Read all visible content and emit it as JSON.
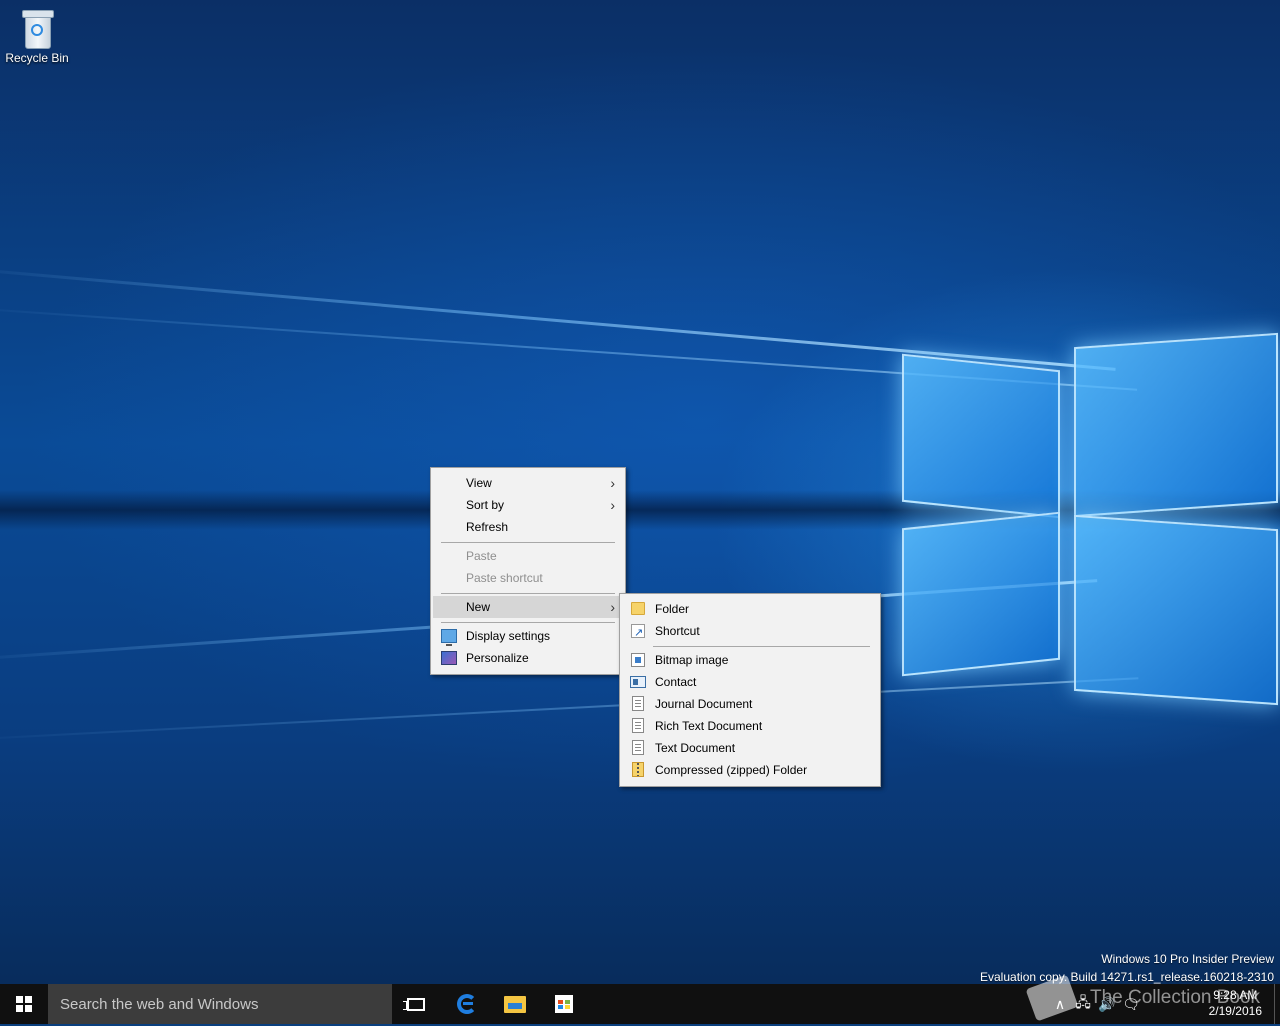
{
  "desktop": {
    "icons": [
      {
        "label": "Recycle Bin",
        "icon": "recycle-bin-icon"
      }
    ]
  },
  "context_menu": {
    "items": [
      {
        "label": "View",
        "has_submenu": true,
        "disabled": false
      },
      {
        "label": "Sort by",
        "has_submenu": true,
        "disabled": false
      },
      {
        "label": "Refresh",
        "has_submenu": false,
        "disabled": false
      },
      {
        "label": "Paste",
        "has_submenu": false,
        "disabled": true
      },
      {
        "label": "Paste shortcut",
        "has_submenu": false,
        "disabled": true
      },
      {
        "label": "New",
        "has_submenu": true,
        "disabled": false,
        "highlighted": true
      },
      {
        "label": "Display settings",
        "icon": "display-settings-icon"
      },
      {
        "label": "Personalize",
        "icon": "personalize-icon"
      }
    ]
  },
  "new_submenu": {
    "items": [
      {
        "label": "Folder",
        "icon": "folder-icon"
      },
      {
        "label": "Shortcut",
        "icon": "shortcut-icon"
      },
      {
        "label": "Bitmap image",
        "icon": "bitmap-icon"
      },
      {
        "label": "Contact",
        "icon": "contact-icon"
      },
      {
        "label": "Journal Document",
        "icon": "journal-icon"
      },
      {
        "label": "Rich Text Document",
        "icon": "rich-text-icon"
      },
      {
        "label": "Text Document",
        "icon": "text-document-icon"
      },
      {
        "label": "Compressed (zipped) Folder",
        "icon": "zip-folder-icon"
      }
    ]
  },
  "watermark": {
    "line1": "Windows 10 Pro Insider Preview",
    "line2": "Evaluation copy. Build 14271.rs1_release.160218-2310"
  },
  "taskbar": {
    "search_placeholder": "Search the web and Windows",
    "pinned": [
      "task-view-icon",
      "edge-icon",
      "file-explorer-icon",
      "store-icon"
    ],
    "clock_time": "9:28 AM",
    "clock_date": "2/19/2016",
    "overlay_text": "The Collection Book"
  },
  "colors": {
    "taskbar": "#101010",
    "search": "#3c3c3c",
    "menu": "#f2f2f2",
    "highlight": "#d6d6d6"
  }
}
